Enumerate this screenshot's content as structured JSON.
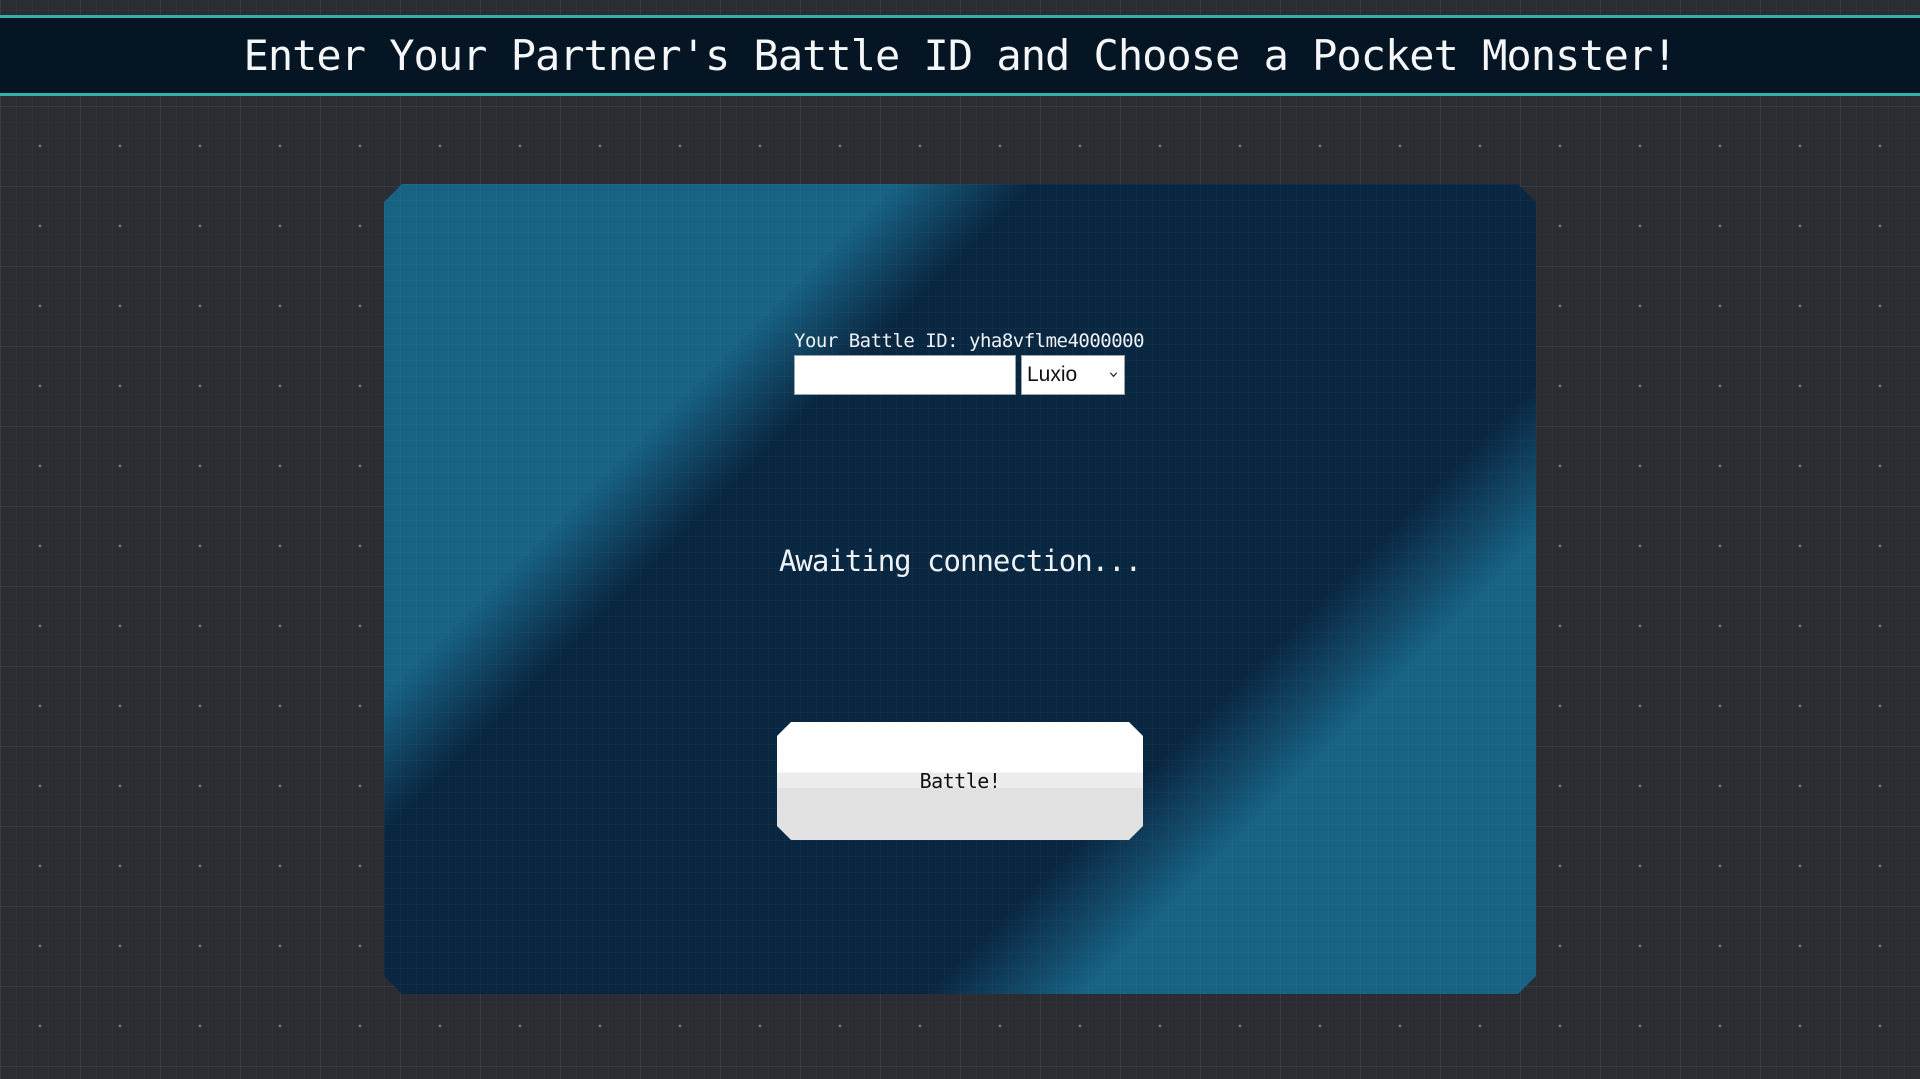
{
  "header": {
    "title": "Enter Your Partner's Battle ID and Choose a Pocket Monster!"
  },
  "form": {
    "battle_id_label": "Your Battle ID: yha8vflme4000000",
    "partner_id_value": "",
    "monster_select": {
      "selected": "Luxio",
      "icon": "chevron-down-icon"
    }
  },
  "status": {
    "text": "Awaiting connection..."
  },
  "actions": {
    "battle_label": "Battle!"
  },
  "colors": {
    "header_bg": "#051524",
    "header_border": "#33b3a6",
    "panel_dark": "#0a2742",
    "panel_stripe": "#186384",
    "page_bg": "#2b2d33"
  }
}
